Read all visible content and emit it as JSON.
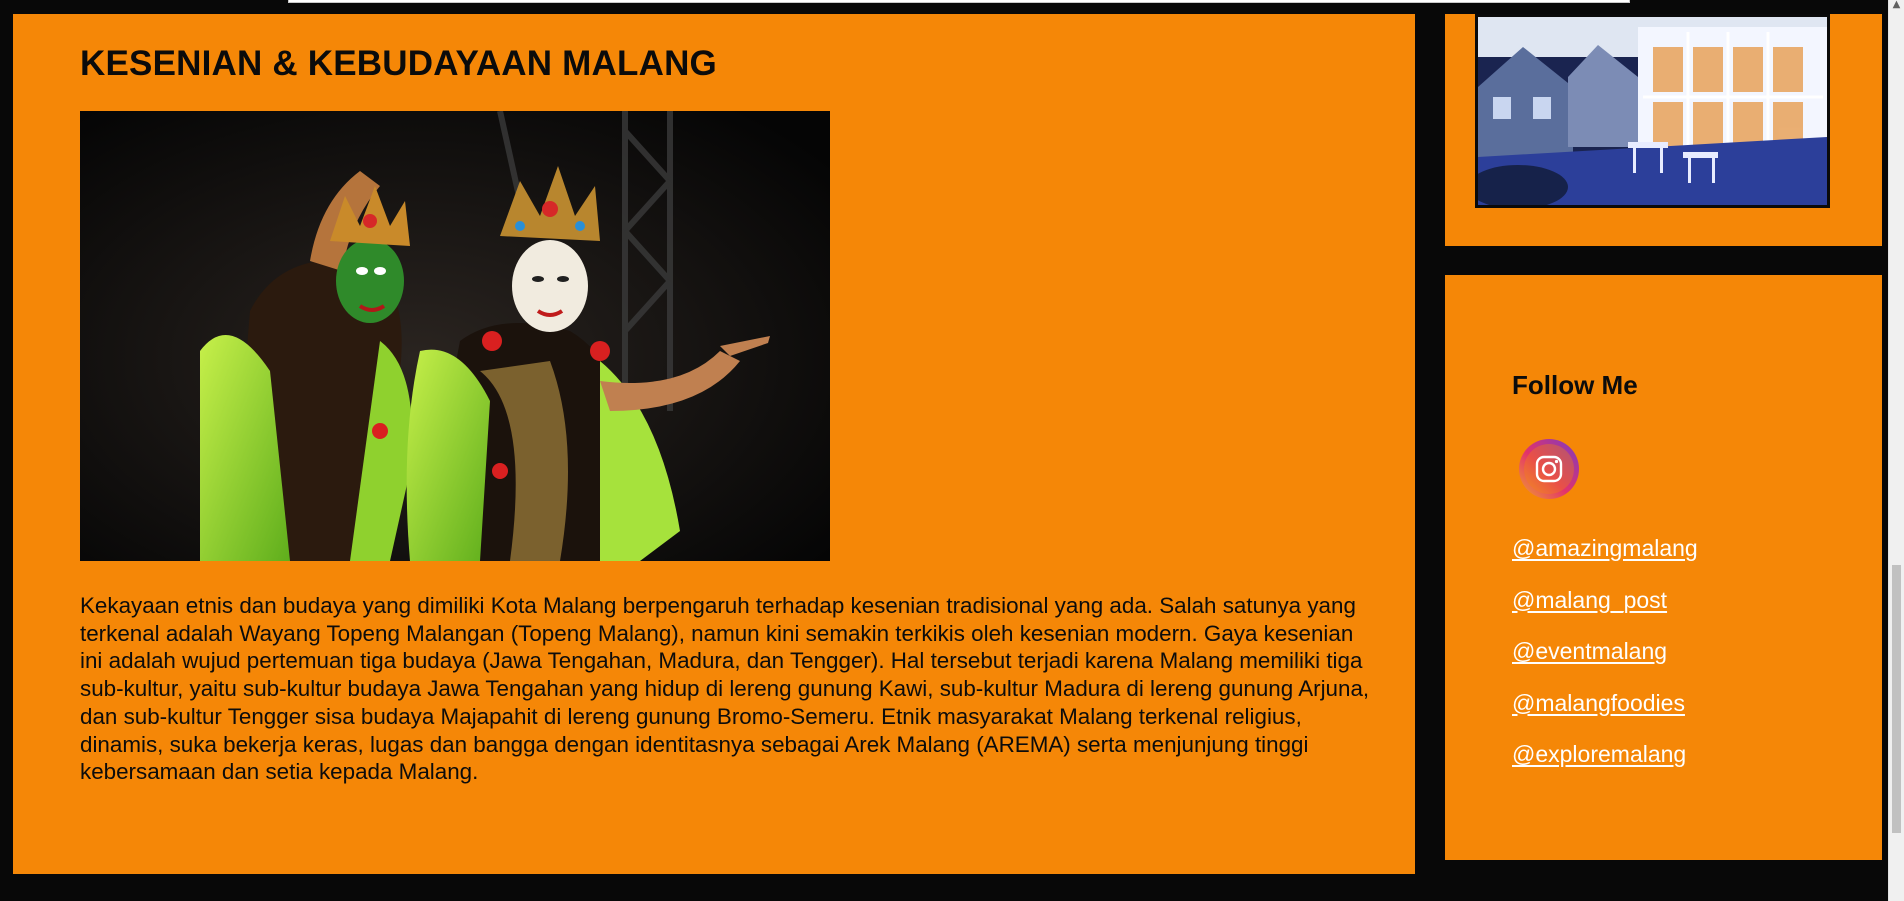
{
  "article": {
    "title": "KESENIAN & KEBUDAYAAN MALANG",
    "image_alt": "Penari Wayang Topeng Malangan",
    "body": "Kekayaan etnis dan budaya yang dimiliki Kota Malang berpengaruh terhadap kesenian tradisional yang ada. Salah satunya yang terkenal adalah Wayang Topeng Malangan (Topeng Malang), namun kini semakin terkikis oleh kesenian modern. Gaya kesenian ini adalah wujud pertemuan tiga budaya (Jawa Tengahan, Madura, dan Tengger). Hal tersebut terjadi karena Malang memiliki tiga sub-kultur, yaitu sub-kultur budaya Jawa Tengahan yang hidup di lereng gunung Kawi, sub-kultur Madura di lereng gunung Arjuna, dan sub-kultur Tengger sisa budaya Majapahit di lereng gunung Bromo-Semeru. Etnik masyarakat Malang terkenal religius, dinamis, suka bekerja keras, lugas dan bangga dengan identitasnya sebagai Arek Malang (AREMA) serta menjunjung tinggi kebersamaan dan setia kepada Malang."
  },
  "sidebar": {
    "follow": {
      "title": "Follow Me",
      "icon": "instagram-icon",
      "handles": [
        "@amazingmalang",
        "@malang_post",
        "@eventmalang",
        "@malangfoodies",
        "@exploremalang"
      ]
    }
  },
  "colors": {
    "panel": "#f58707",
    "background": "#080808",
    "link": "#ffffff",
    "text": "#0c0c0c"
  }
}
